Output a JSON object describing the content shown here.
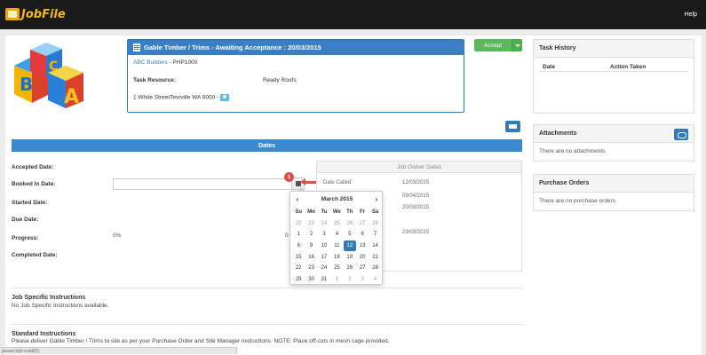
{
  "topbar": {
    "logo_text": "JobFile",
    "help_label": "Help"
  },
  "job": {
    "title": "Gable Timber / Trims - Awaiting Acceptance : 20/03/2015",
    "client_link": "ABC Builders",
    "client_code": " - PHP1000",
    "resource_label": "Task Resource:",
    "resource_value": "Ready Roofs",
    "address": "1 White StreetTestville WA 6000 - "
  },
  "actions": {
    "accept_label": "Accept"
  },
  "dates": {
    "bar_title": "Dates",
    "labels": [
      "Accepted Date:",
      "Booked In Date:",
      "Started Date:",
      "Due Date:",
      "Progress:",
      "Completed Date:"
    ],
    "progress_left": "0%",
    "progress_right": "0",
    "badge": "1"
  },
  "owner_dates": {
    "title": "Job Owner Dates",
    "rows": [
      {
        "label": "Date Called",
        "date": "12/03/2015"
      },
      {
        "label": "",
        "date": "09/04/2015"
      },
      {
        "label": "",
        "date": "20/03/2015"
      },
      {
        "label": "",
        "date": "23/03/2015"
      }
    ]
  },
  "calendar": {
    "month": "March 2015",
    "prev": "‹",
    "next": "›",
    "dow": [
      "Su",
      "Mo",
      "Tu",
      "We",
      "Th",
      "Fr",
      "Sa"
    ],
    "weeks": [
      [
        "22",
        "23",
        "24",
        "25",
        "26",
        "27",
        "28"
      ],
      [
        "1",
        "2",
        "3",
        "4",
        "5",
        "6",
        "7"
      ],
      [
        "8",
        "9",
        "10",
        "11",
        "12",
        "13",
        "14"
      ],
      [
        "15",
        "16",
        "17",
        "18",
        "19",
        "20",
        "21"
      ],
      [
        "22",
        "23",
        "24",
        "25",
        "26",
        "27",
        "28"
      ],
      [
        "29",
        "30",
        "31",
        "1",
        "2",
        "3",
        "4"
      ]
    ],
    "selected": "12"
  },
  "instructions": {
    "job_title": "Job Specific Instructions",
    "job_text": "No Job Specific Instructions available.",
    "std_title": "Standard Instructions",
    "std_text": "Please deliver Gable Timber / Trims to site as per your Purchase Order and Site Manager instructions. NOTE: Place off-cuts in mesh cage provided."
  },
  "task_history": {
    "title": "Task History",
    "col_date": "Date",
    "col_action": "Action Taken"
  },
  "attachments": {
    "title": "Attachments",
    "empty": "There are no attachments."
  },
  "purchase_orders": {
    "title": "Purchase Orders",
    "empty": "There are no purchase orders"
  },
  "statusbar": {
    "text": "javascript:void(0);"
  }
}
